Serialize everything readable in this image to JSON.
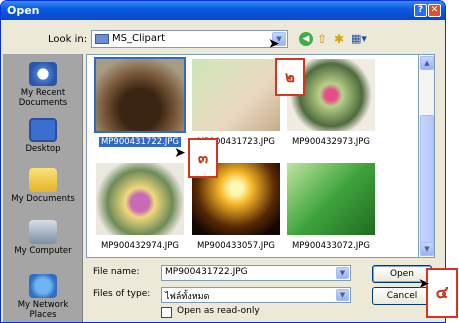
{
  "title_bar": {
    "title": "Open",
    "help_label": "?",
    "close_label": "✕"
  },
  "toolbar": {
    "look_in_label": "Look in:",
    "look_in_value": "MS_Clipart"
  },
  "places": [
    {
      "label": "My Recent Documents",
      "icon": "recent-documents-icon"
    },
    {
      "label": "Desktop",
      "icon": "desktop-icon"
    },
    {
      "label": "My Documents",
      "icon": "my-documents-icon"
    },
    {
      "label": "My Computer",
      "icon": "my-computer-icon"
    },
    {
      "label": "My Network Places",
      "icon": "network-places-icon"
    }
  ],
  "files": [
    {
      "name": "MP900431722.JPG",
      "selected": true
    },
    {
      "name": "MP900431723.JPG",
      "selected": false
    },
    {
      "name": "MP900432973.JPG",
      "selected": false
    },
    {
      "name": "MP900432974.JPG",
      "selected": false
    },
    {
      "name": "MP900433057.JPG",
      "selected": false
    },
    {
      "name": "MP900433072.JPG",
      "selected": false
    }
  ],
  "bottom": {
    "file_name_label": "File name:",
    "file_name_value": "MP900431722.JPG",
    "file_type_label": "Files of type:",
    "file_type_value": "ไฟล์ทั้งหมด",
    "read_only_label": "Open as read-only",
    "read_only_checked": false,
    "open_label": "Open",
    "cancel_label": "Cancel"
  },
  "callouts": {
    "two": "๒",
    "three": "๓",
    "four": "๔"
  },
  "colors": {
    "title_bar": "#0a5be0",
    "selection": "#316ac5",
    "callout_border": "#d8331f"
  }
}
